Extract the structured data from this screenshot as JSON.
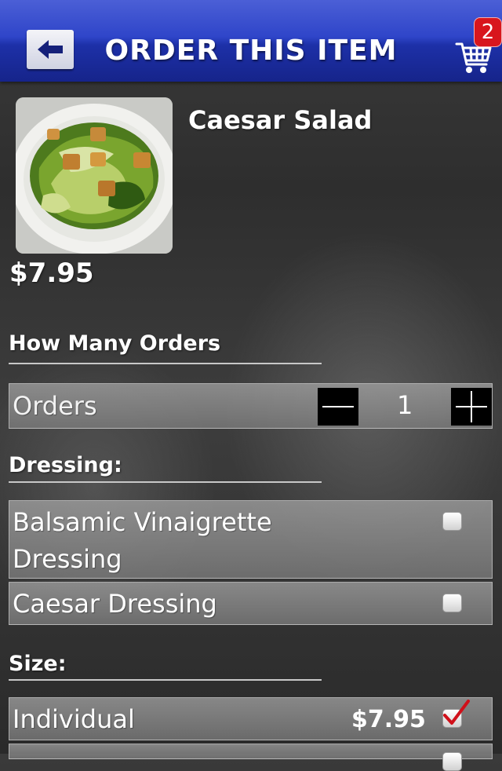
{
  "header": {
    "title": "ORDER THIS ITEM",
    "back_icon": "arrow-left-icon",
    "cart_icon": "shopping-cart-icon",
    "cart_count": "2"
  },
  "item": {
    "name": "Caesar Salad",
    "price": "$7.95",
    "image_icon": "caesar-salad-photo"
  },
  "orders_section": {
    "heading": "How Many Orders",
    "row_label": "Orders",
    "quantity": "1"
  },
  "dressing_section": {
    "heading": "Dressing:",
    "options": [
      {
        "label": "Balsamic Vinaigrette Dressing",
        "checked": false
      },
      {
        "label": "Caesar Dressing",
        "checked": false
      }
    ]
  },
  "size_section": {
    "heading": "Size:",
    "options": [
      {
        "label": "Individual",
        "price": "$7.95",
        "checked": true
      }
    ]
  },
  "colors": {
    "header_blue": "#2f45c9",
    "badge_red": "#d8161d",
    "check_red": "#d0101a"
  }
}
